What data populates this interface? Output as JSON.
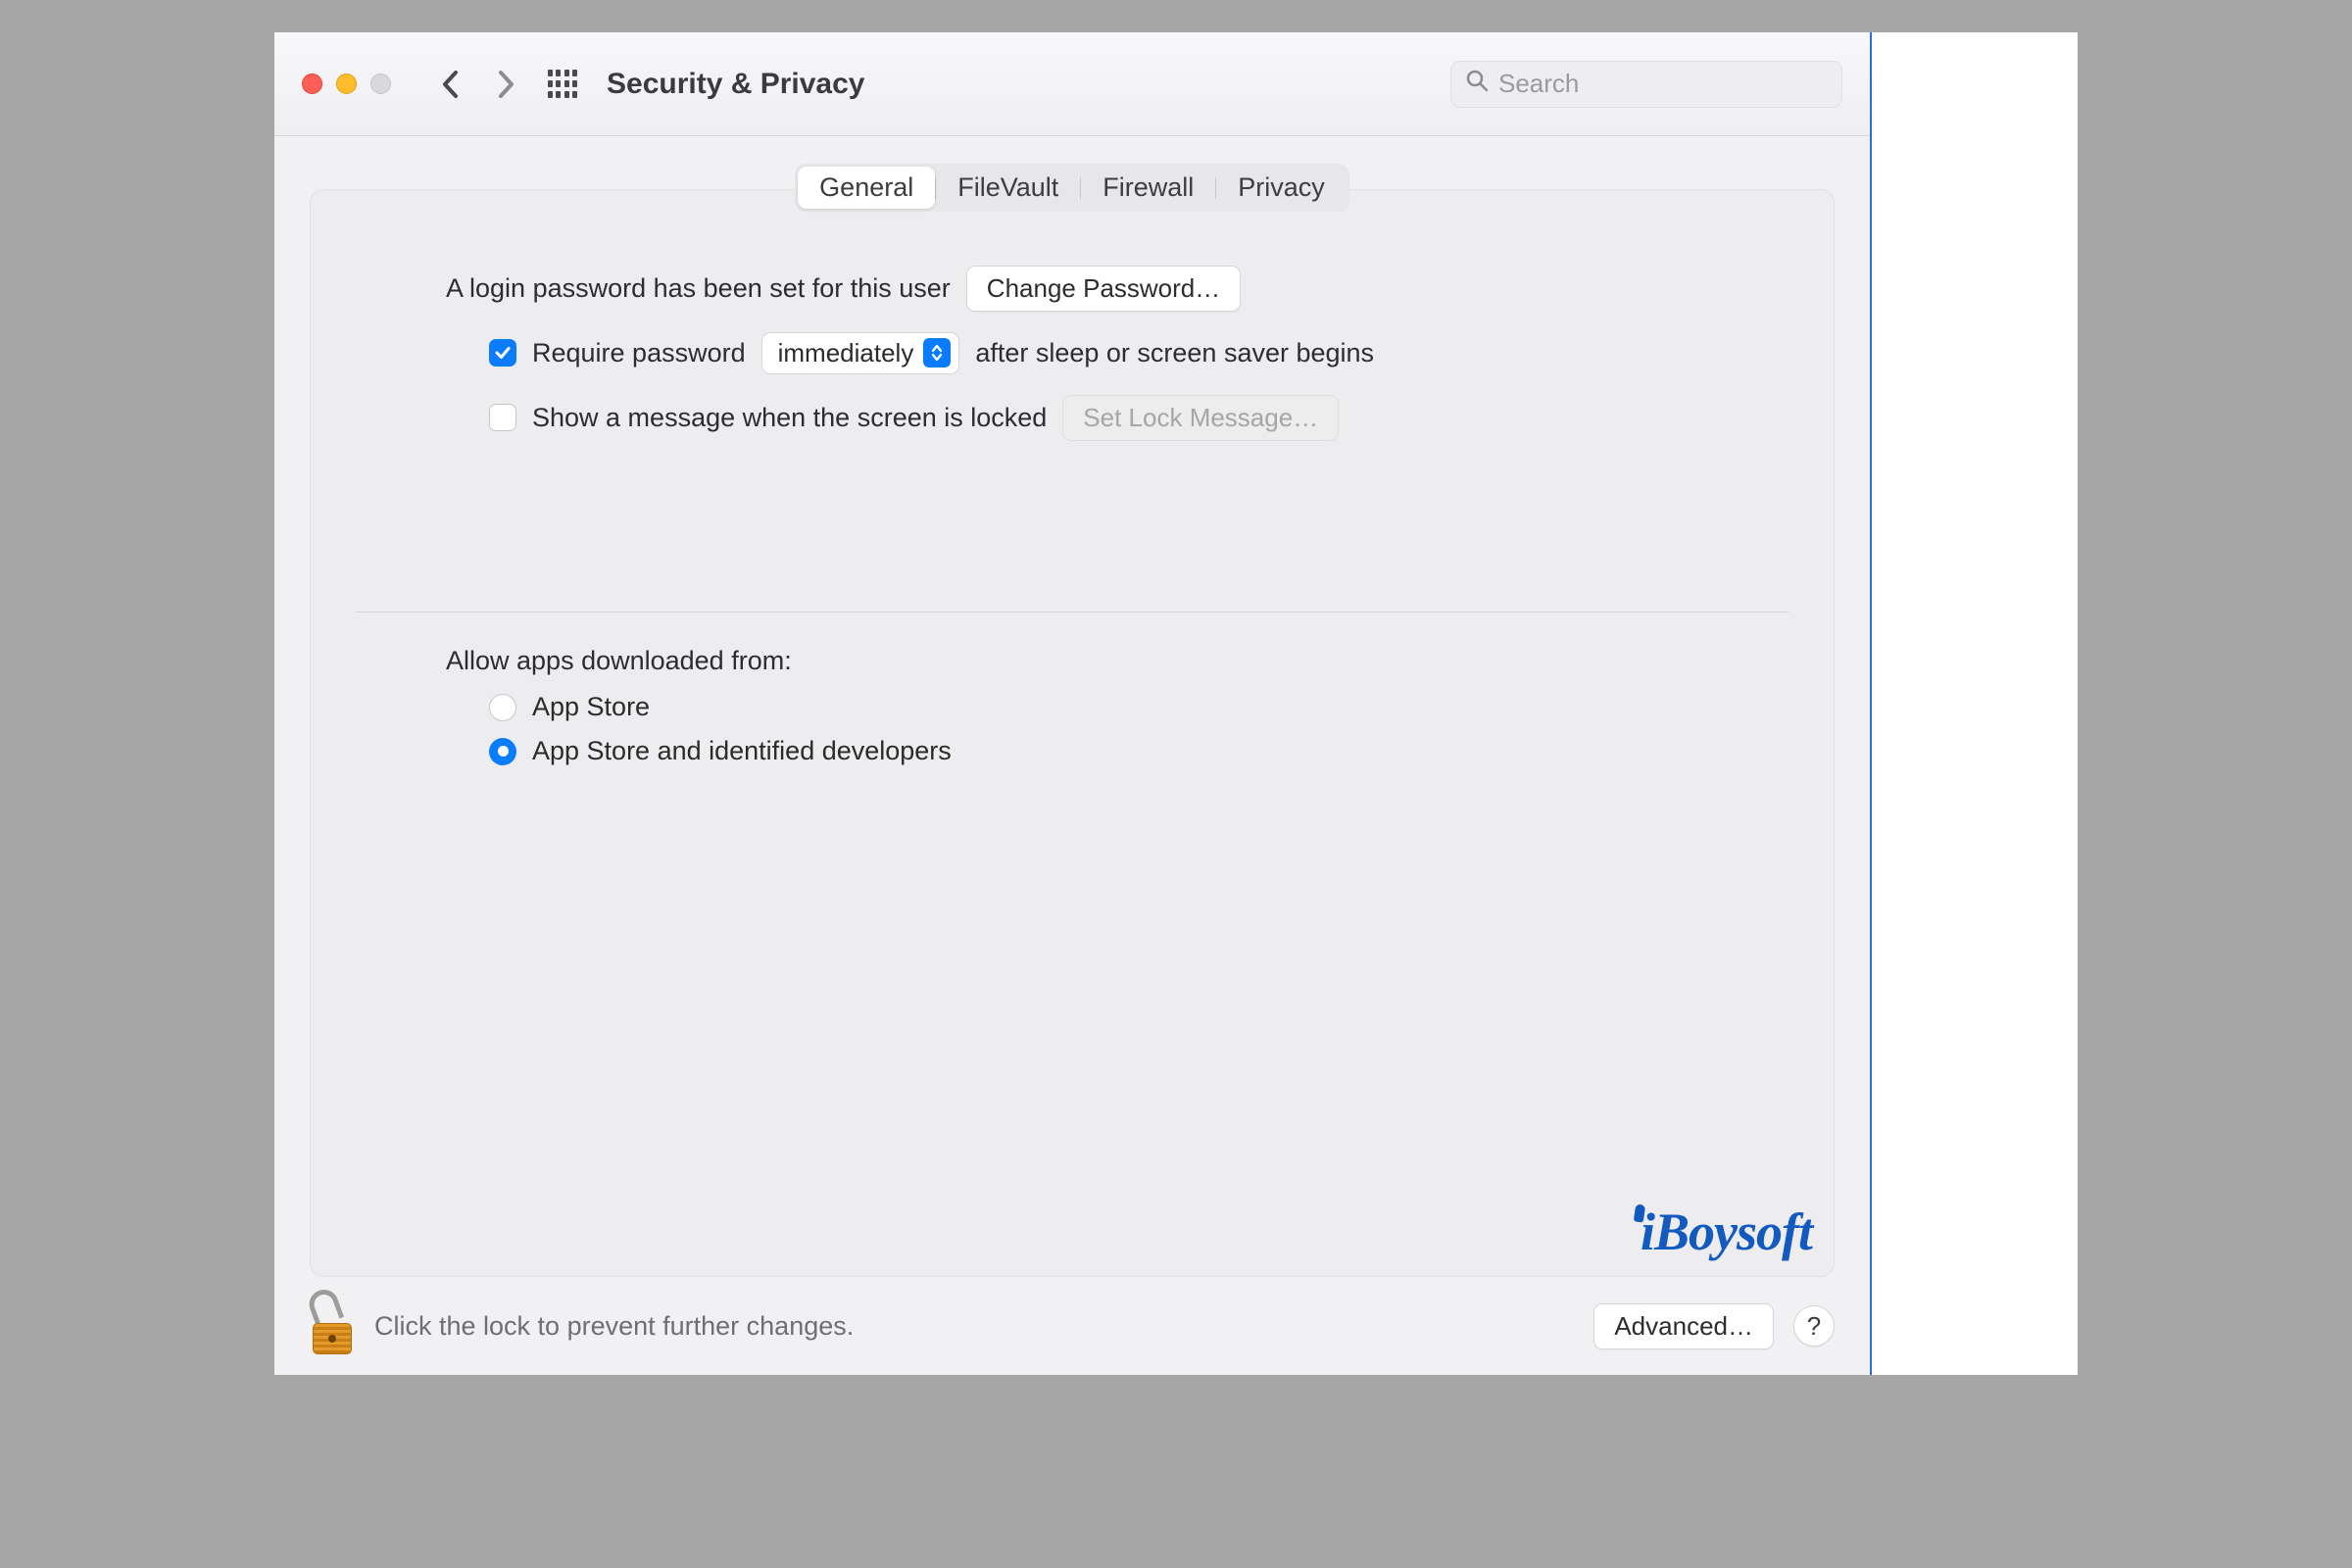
{
  "window": {
    "title": "Security & Privacy",
    "search_placeholder": "Search"
  },
  "tabs": {
    "general": "General",
    "filevault": "FileVault",
    "firewall": "Firewall",
    "privacy": "Privacy",
    "active": "general"
  },
  "general": {
    "login_password_set_label": "A login password has been set for this user",
    "change_password_button": "Change Password…",
    "require_password_checkbox_checked": true,
    "require_password_prefix": "Require password",
    "require_password_delay_selected": "immediately",
    "require_password_suffix": "after sleep or screen saver begins",
    "show_lock_message_checkbox_checked": false,
    "show_lock_message_label": "Show a message when the screen is locked",
    "set_lock_message_button": "Set Lock Message…",
    "allow_apps_heading": "Allow apps downloaded from:",
    "allow_apps_options": {
      "app_store": "App Store",
      "app_store_identified": "App Store and identified developers"
    },
    "allow_apps_selected": "app_store_identified"
  },
  "footer": {
    "lock_hint": "Click the lock to prevent further changes.",
    "advanced_button": "Advanced…",
    "help_button": "?"
  },
  "watermark": "iBoysoft",
  "colors": {
    "accent": "#0a7cff",
    "brand": "#125ac0"
  }
}
